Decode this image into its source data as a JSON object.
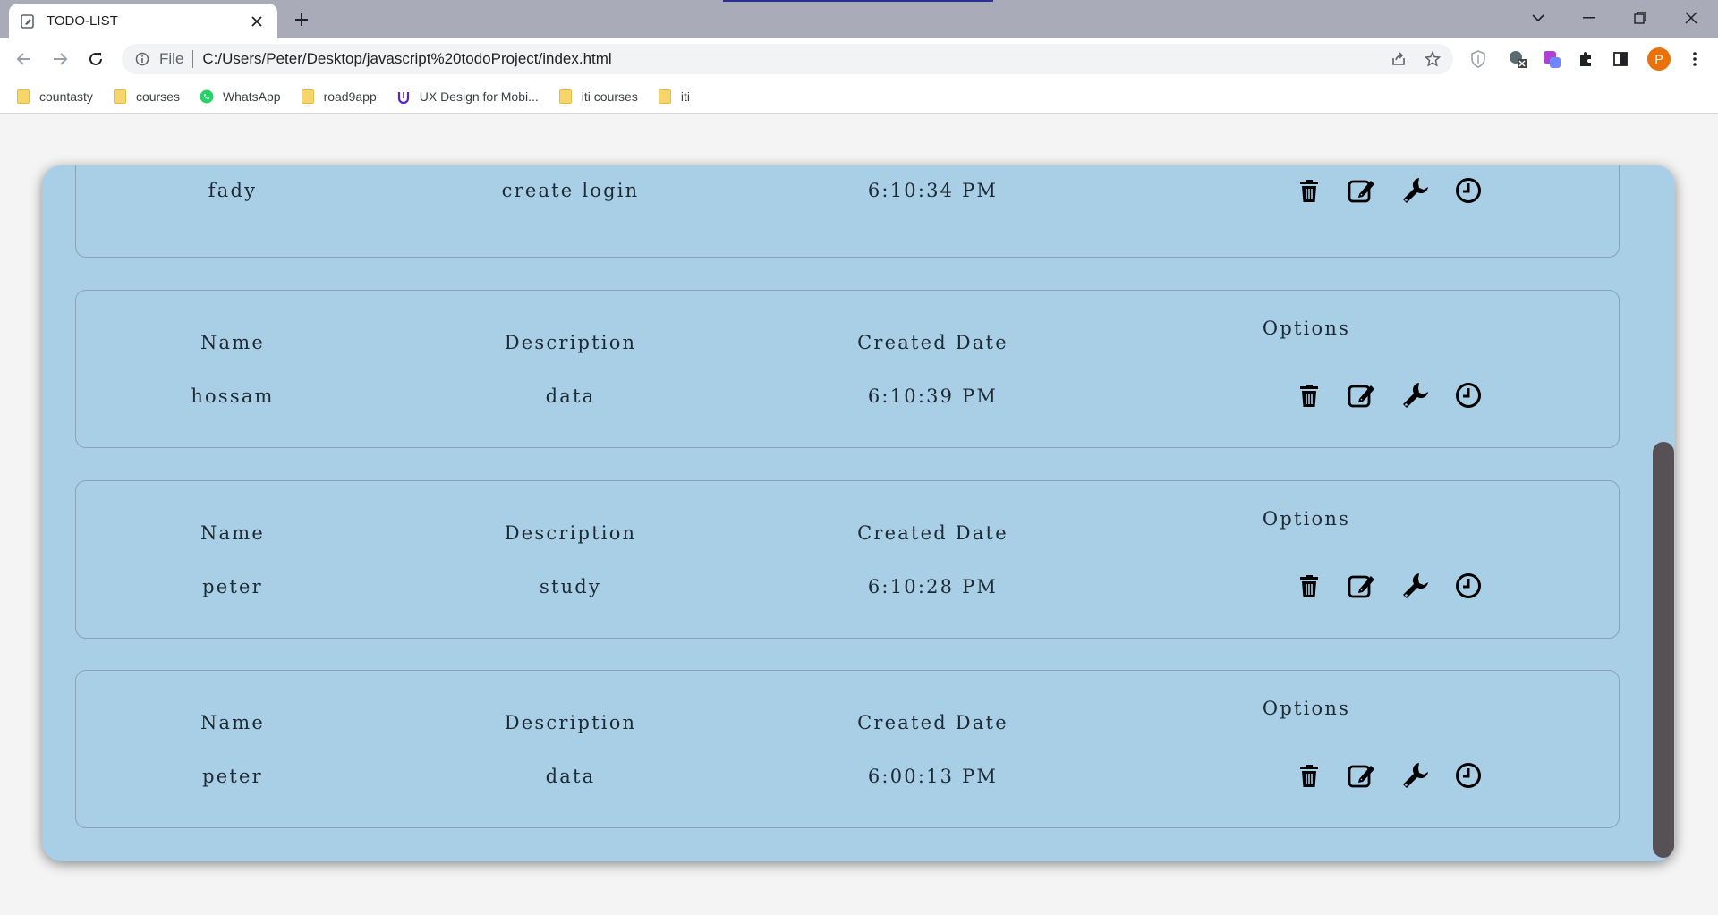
{
  "browser": {
    "tab_title": "TODO-LIST",
    "new_tab": "+",
    "omnibox": {
      "scheme_label": "File",
      "url": "C:/Users/Peter/Desktop/javascript%20todoProject/index.html"
    },
    "profile_initial": "P",
    "bookmarks": [
      {
        "label": "countasty",
        "icon": "folder-icon"
      },
      {
        "label": "courses",
        "icon": "folder-icon"
      },
      {
        "label": "WhatsApp",
        "icon": "whatsapp-icon"
      },
      {
        "label": "road9app",
        "icon": "folder-icon"
      },
      {
        "label": "UX Design for Mobi...",
        "icon": "udemy-icon"
      },
      {
        "label": "iti courses",
        "icon": "folder-icon"
      },
      {
        "label": "iti",
        "icon": "folder-icon"
      }
    ]
  },
  "todos": {
    "headers": {
      "name": "Name",
      "description": "Description",
      "created": "Created Date",
      "options": "Options"
    },
    "items": [
      {
        "name": "fady",
        "description": "create login",
        "created": "6:10:34 PM"
      },
      {
        "name": "hossam",
        "description": "data",
        "created": "6:10:39 PM"
      },
      {
        "name": "peter",
        "description": "study",
        "created": "6:10:28 PM"
      },
      {
        "name": "peter",
        "description": "data",
        "created": "6:00:13 PM"
      }
    ],
    "option_icons": [
      "trash-icon",
      "edit-icon",
      "wrench-icon",
      "clock-icon"
    ]
  },
  "colors": {
    "container_bg": "#a9cfe6",
    "page_bg": "#f4f4f4",
    "scroll_thumb": "#575055",
    "profile": "#e8710a"
  }
}
